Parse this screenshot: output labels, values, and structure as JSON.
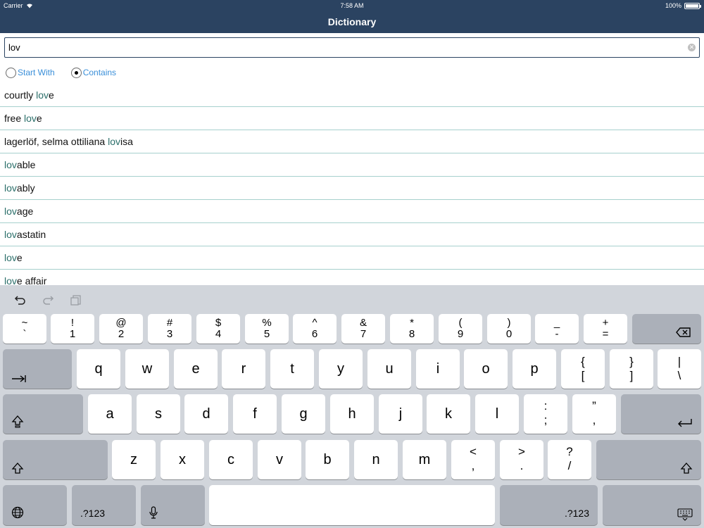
{
  "status": {
    "carrier": "Carrier",
    "time": "7:58 AM",
    "battery": "100%"
  },
  "nav": {
    "title": "Dictionary"
  },
  "search": {
    "value": "lov"
  },
  "radios": [
    {
      "label": "Start With",
      "checked": false
    },
    {
      "label": "Contains",
      "checked": true
    }
  ],
  "results": [
    {
      "pre": "courtly ",
      "hl": "lov",
      "post": "e"
    },
    {
      "pre": "free ",
      "hl": "lov",
      "post": "e"
    },
    {
      "pre": "lagerlöf, selma ottiliana ",
      "hl": "lov",
      "post": "isa"
    },
    {
      "pre": "",
      "hl": "lov",
      "post": "able"
    },
    {
      "pre": "",
      "hl": "lov",
      "post": "ably"
    },
    {
      "pre": "",
      "hl": "lov",
      "post": "age"
    },
    {
      "pre": "",
      "hl": "lov",
      "post": "astatin"
    },
    {
      "pre": "",
      "hl": "lov",
      "post": "e"
    },
    {
      "pre": "",
      "hl": "lov",
      "post": "e affair"
    }
  ],
  "keyboard": {
    "row1": [
      {
        "top": "~",
        "bot": "`"
      },
      {
        "top": "!",
        "bot": "1"
      },
      {
        "top": "@",
        "bot": "2"
      },
      {
        "top": "#",
        "bot": "3"
      },
      {
        "top": "$",
        "bot": "4"
      },
      {
        "top": "%",
        "bot": "5"
      },
      {
        "top": "^",
        "bot": "6"
      },
      {
        "top": "&",
        "bot": "7"
      },
      {
        "top": "*",
        "bot": "8"
      },
      {
        "top": "(",
        "bot": "9"
      },
      {
        "top": ")",
        "bot": "0"
      },
      {
        "top": "_",
        "bot": "-"
      },
      {
        "top": "+",
        "bot": "="
      }
    ],
    "row2": [
      "q",
      "w",
      "e",
      "r",
      "t",
      "y",
      "u",
      "i",
      "o",
      "p"
    ],
    "row2_sym": [
      {
        "top": "{",
        "bot": "["
      },
      {
        "top": "}",
        "bot": "]"
      },
      {
        "top": "|",
        "bot": "\\"
      }
    ],
    "row3": [
      "a",
      "s",
      "d",
      "f",
      "g",
      "h",
      "j",
      "k",
      "l"
    ],
    "row3_sym": [
      {
        "top": ":",
        "bot": ";"
      },
      {
        "top": "”",
        "bot": ","
      }
    ],
    "row4": [
      "z",
      "x",
      "c",
      "v",
      "b",
      "n",
      "m"
    ],
    "row4_sym": [
      {
        "top": "<",
        "bot": ","
      },
      {
        "top": ">",
        "bot": "."
      },
      {
        "top": "?",
        "bot": "/"
      }
    ],
    "numbers_label": ".?123"
  }
}
